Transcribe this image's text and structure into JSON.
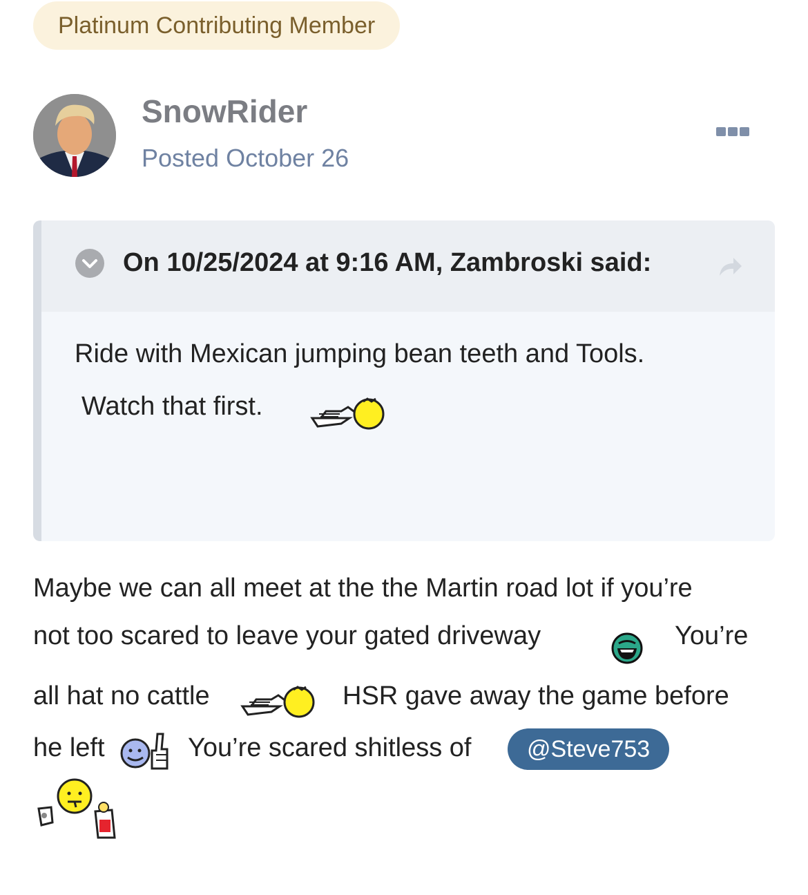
{
  "badge": {
    "label": "Platinum Contributing Member"
  },
  "post": {
    "author": "SnowRider",
    "posted": "Posted October 26",
    "menu_icon": "ellipsis-icon"
  },
  "quote": {
    "header": "On 10/25/2024 at 9:16 AM, Zambroski said:",
    "line1": "Ride with Mexican jumping bean teeth and Tools.",
    "line2": "Watch that first.",
    "toggle_icon": "chevron-down-circle-icon",
    "share_icon": "share-arrow-icon"
  },
  "body": {
    "line1": "Maybe we can all meet at the the Martin road lot if you’re",
    "line2a": "not too scared to leave your gated driveway",
    "line2b": "You’re",
    "line3a": "all hat no cattle",
    "line3b": "HSR gave away the game before",
    "line4a": "he left",
    "line4b": "You’re scared shitless of",
    "mention": "@Steve753"
  },
  "colors": {
    "badge_bg": "#fbf2dd",
    "badge_text": "#7a5f2c",
    "mention_bg": "#3d6a96",
    "posted_text": "#6f82a2"
  }
}
